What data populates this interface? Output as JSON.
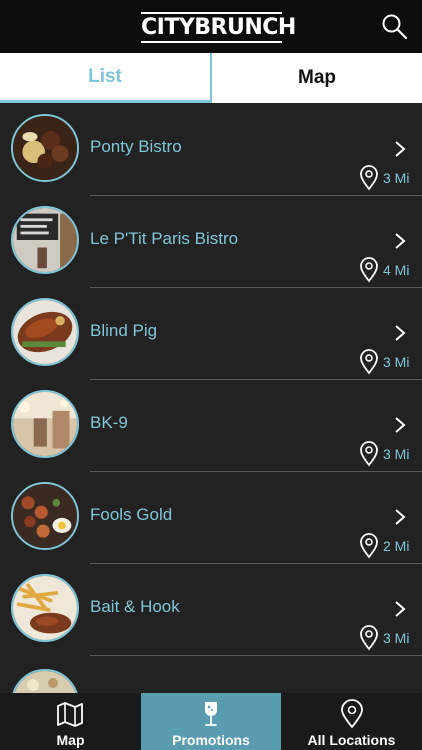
{
  "header": {
    "logo_text": "CITYBRUNCH",
    "search_icon": "search-icon"
  },
  "tabs": [
    {
      "label": "List",
      "active": true
    },
    {
      "label": "Map",
      "active": false
    }
  ],
  "restaurants": [
    {
      "name": "Ponty Bistro",
      "distance": "3 Mi"
    },
    {
      "name": "Le P'Tit Paris Bistro",
      "distance": "4 Mi"
    },
    {
      "name": "Blind Pig",
      "distance": "3 Mi"
    },
    {
      "name": "BK-9",
      "distance": "3 Mi"
    },
    {
      "name": "Fools Gold",
      "distance": "2 Mi"
    },
    {
      "name": "Bait & Hook",
      "distance": "3 Mi"
    }
  ],
  "bottom_nav": [
    {
      "label": "Map",
      "icon": "map-icon",
      "active": false
    },
    {
      "label": "Promotions",
      "icon": "wine-glass-icon",
      "active": true
    },
    {
      "label": "All Locations",
      "icon": "location-pin-icon",
      "active": false
    }
  ],
  "colors": {
    "accent": "#7fc6d8",
    "background": "#222222",
    "header": "#0d0d0d",
    "active_nav": "#5a9caf"
  }
}
